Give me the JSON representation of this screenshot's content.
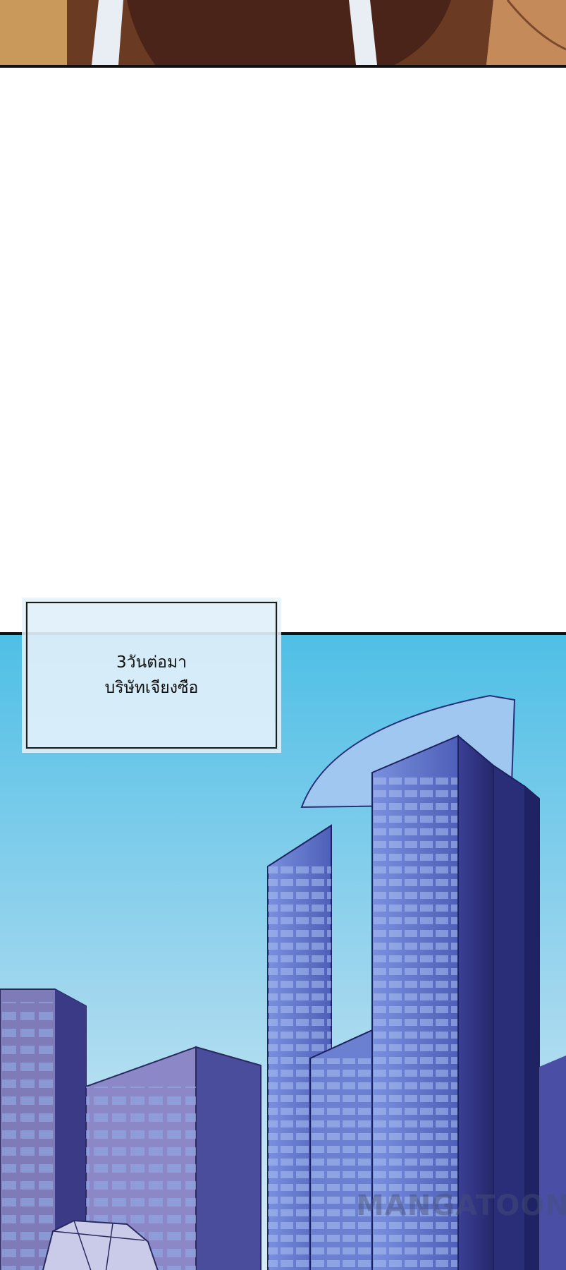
{
  "caption": {
    "line1": "3วันต่อมา",
    "line2": "บริษัทเจียงซือ"
  },
  "watermark": "MANGATOON",
  "colors": {
    "sky_top": "#4fbfe6",
    "sky_bottom": "#d8ecf4",
    "tower_main": "#5f74c8",
    "tower_shadow": "#2a2f7a",
    "panel_border": "#111111",
    "caption_bg": "#e1f0fa"
  },
  "icons": {
    "watermark_logo": "mangatoon-wordmark"
  }
}
